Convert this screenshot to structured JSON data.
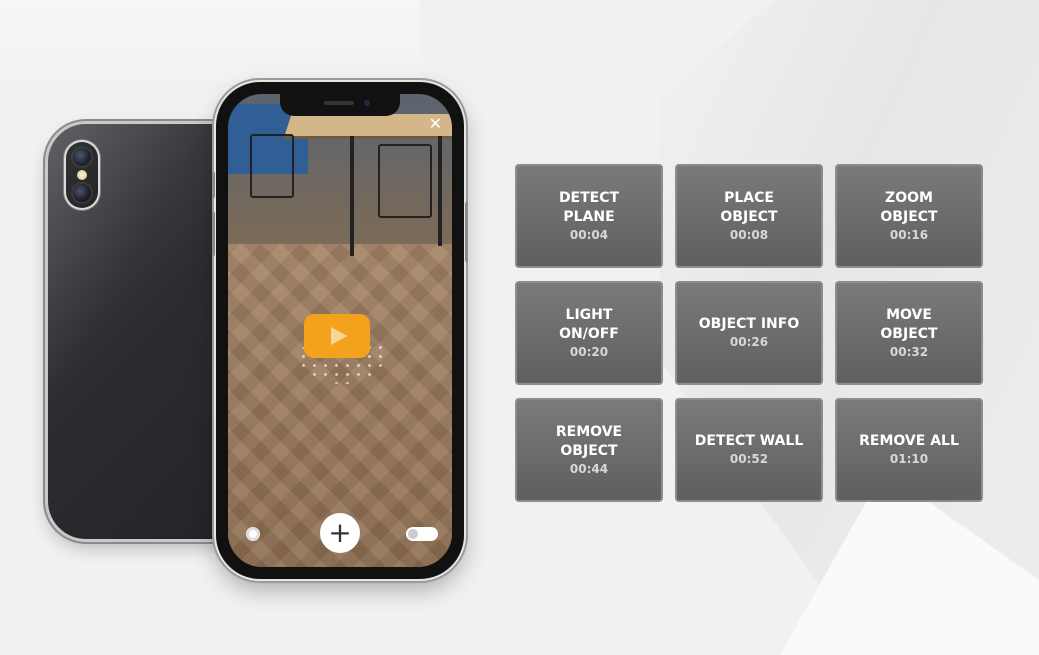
{
  "phone": {
    "close_glyph": "✕",
    "add_glyph": "+",
    "icons": [
      "close-icon",
      "play-icon",
      "add-icon",
      "toggle-icon"
    ]
  },
  "features": [
    {
      "id": "detect-plane",
      "label": "DETECT\nPLANE",
      "time": "00:04"
    },
    {
      "id": "place-object",
      "label": "PLACE\nOBJECT",
      "time": "00:08"
    },
    {
      "id": "zoom-object",
      "label": "ZOOM\nOBJECT",
      "time": "00:16"
    },
    {
      "id": "light-on-off",
      "label": "LIGHT\nON/OFF",
      "time": "00:20"
    },
    {
      "id": "object-info",
      "label": "OBJECT INFO",
      "time": "00:26"
    },
    {
      "id": "move-object",
      "label": "MOVE\nOBJECT",
      "time": "00:32"
    },
    {
      "id": "remove-object",
      "label": "REMOVE\nOBJECT",
      "time": "00:44"
    },
    {
      "id": "detect-wall",
      "label": "DETECT WALL",
      "time": "00:52"
    },
    {
      "id": "remove-all",
      "label": "REMOVE ALL",
      "time": "01:10"
    }
  ],
  "colors": {
    "accent_play": "#f3a21c",
    "button_bg": "#6e6e6e",
    "page_bg": "#f1f1f1"
  }
}
